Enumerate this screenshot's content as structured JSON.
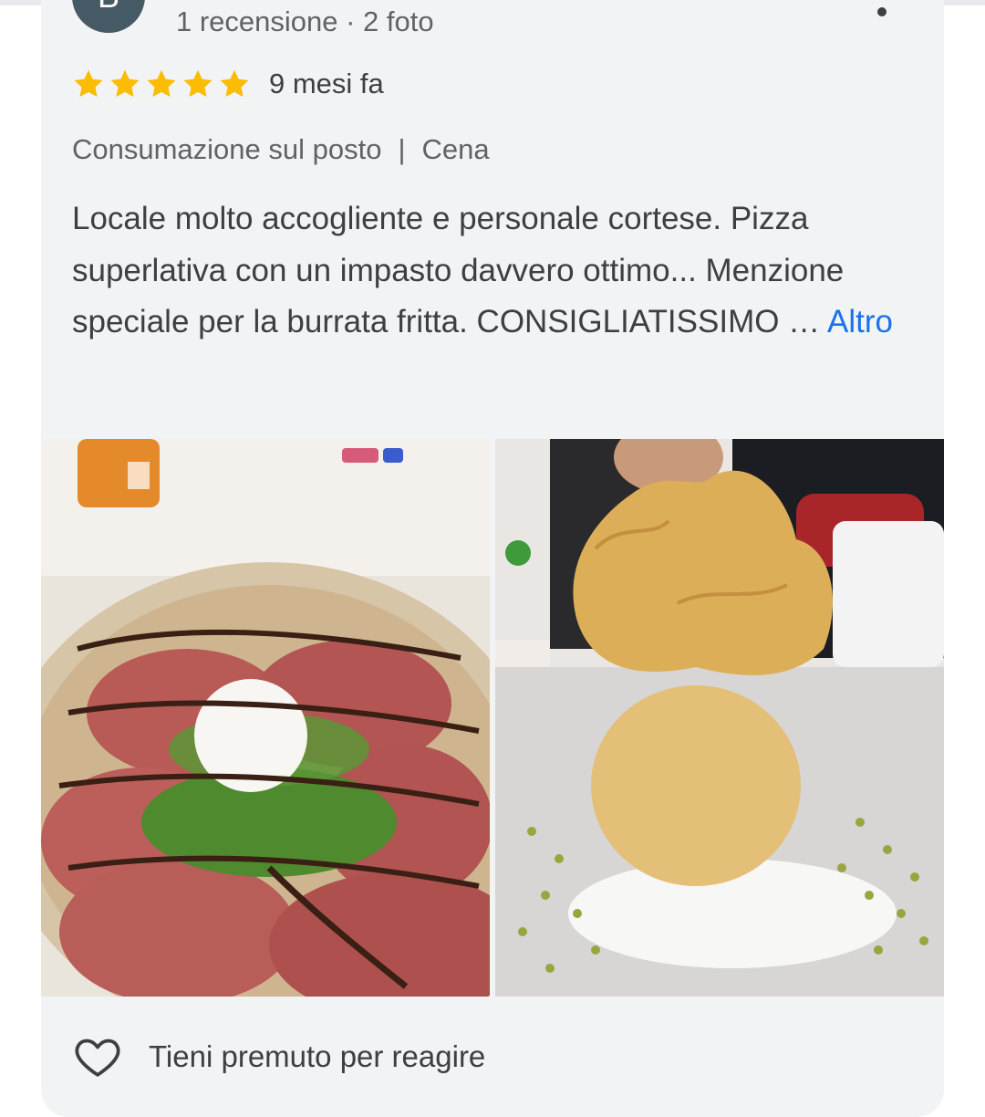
{
  "reviewer": {
    "avatar_letter": "B",
    "meta": "1 recensione · 2 foto"
  },
  "rating": {
    "stars": 5,
    "max_stars": 5,
    "time_ago": "9 mesi fa"
  },
  "tags": {
    "service": "Consumazione sul posto",
    "separator": "|",
    "meal": "Cena"
  },
  "review": {
    "text": "Locale molto accogliente e personale cortese. Pizza superlativa con un impasto davvero ottimo... Menzione speciale per la burrata fritta. CONSIGLIATISSIMO …",
    "more_label": "Altro"
  },
  "photos": [
    {
      "subject": "pizza-photo"
    },
    {
      "subject": "fried-burrata-photo"
    }
  ],
  "reaction": {
    "hint": "Tieni premuto per reagire"
  },
  "colors": {
    "star": "#fbbc04",
    "link": "#1a73e8",
    "card_bg": "#f2f3f5",
    "text": "#3c4043",
    "muted": "#5f6368"
  }
}
